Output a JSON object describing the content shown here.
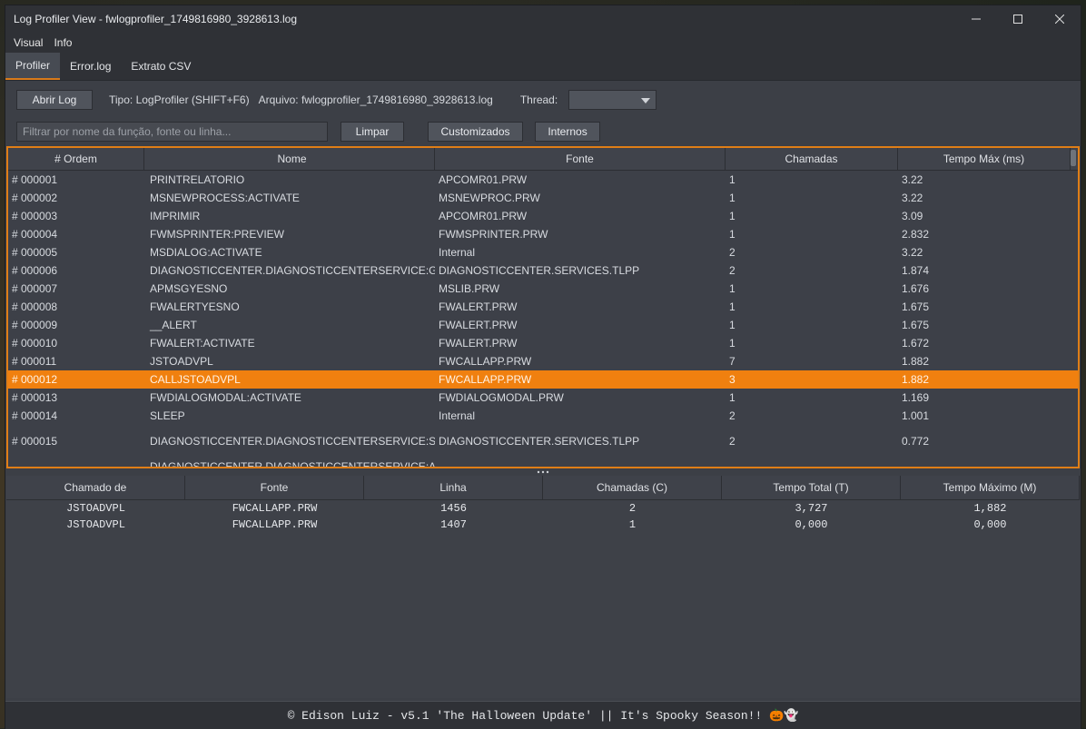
{
  "window": {
    "title": "Log Profiler View - fwlogprofiler_1749816980_3928613.log"
  },
  "menu": [
    "Visual",
    "Info"
  ],
  "tabs": [
    "Profiler",
    "Error.log",
    "Extrato CSV"
  ],
  "toolbar": {
    "open_log": "Abrir Log",
    "type_label": "Tipo: LogProfiler (SHIFT+F6)",
    "file_label": "Arquivo: fwlogprofiler_1749816980_3928613.log",
    "thread_label": "Thread:",
    "thread_value": ""
  },
  "filterbar": {
    "placeholder": "Filtrar por nome da função, fonte ou linha...",
    "clear": "Limpar",
    "custom": "Customizados",
    "internal": "Internos"
  },
  "main_table": {
    "headers": [
      "# Ordem",
      "Nome",
      "Fonte",
      "Chamadas",
      "Tempo Máx (ms)"
    ],
    "selected_index": 11,
    "rows": [
      [
        "# 000001",
        "PRINTRELATORIO",
        "APCOMR01.PRW",
        "1",
        "3.22"
      ],
      [
        "# 000002",
        "MSNEWPROCESS:ACTIVATE",
        "MSNEWPROC.PRW",
        "1",
        "3.22"
      ],
      [
        "# 000003",
        "IMPRIMIR",
        "APCOMR01.PRW",
        "1",
        "3.09"
      ],
      [
        "# 000004",
        "FWMSPRINTER:PREVIEW",
        "FWMSPRINTER.PRW",
        "1",
        "2.832"
      ],
      [
        "# 000005",
        "MSDIALOG:ACTIVATE",
        "Internal",
        "2",
        "3.22"
      ],
      [
        "# 000006",
        "DIAGNOSTICCENTER.DIAGNOSTICCENTERSERVICE:GET",
        "DIAGNOSTICCENTER.SERVICES.TLPP",
        "2",
        "1.874"
      ],
      [
        "# 000007",
        "APMSGYESNO",
        "MSLIB.PRW",
        "1",
        "1.676"
      ],
      [
        "# 000008",
        "FWALERTYESNO",
        "FWALERT.PRW",
        "1",
        "1.675"
      ],
      [
        "# 000009",
        "__ALERT",
        "FWALERT.PRW",
        "1",
        "1.675"
      ],
      [
        "# 000010",
        "FWALERT:ACTIVATE",
        "FWALERT.PRW",
        "1",
        "1.672"
      ],
      [
        "# 000011",
        "JSTOADVPL",
        "FWCALLAPP.PRW",
        "7",
        "1.882"
      ],
      [
        "# 000012",
        "CALLJSTOADVPL",
        "FWCALLAPP.PRW",
        "3",
        "1.882"
      ],
      [
        "# 000013",
        "FWDIALOGMODAL:ACTIVATE",
        "FWDIALOGMODAL.PRW",
        "1",
        "1.169"
      ],
      [
        "# 000014",
        "SLEEP",
        "Internal",
        "2",
        "1.001"
      ],
      [
        "# 000015",
        "DIAGNOSTICCENTER.DIAGNOSTICCENTERSERVICE:SMARTCLIENTRELEASE",
        "DIAGNOSTICCENTER.SERVICES.TLPP",
        "2",
        "0.772"
      ],
      [
        "",
        "DIAGNOSTICCENTER.DIAGNOSTICCENTERSERVICE:APPSE",
        "",
        "",
        ""
      ]
    ]
  },
  "detail_table": {
    "headers": [
      "Chamado de",
      "Fonte",
      "Linha",
      "Chamadas (C)",
      "Tempo Total (T)",
      "Tempo Máximo (M)"
    ],
    "rows": [
      [
        "JSTOADVPL",
        "FWCALLAPP.PRW",
        "1456",
        "2",
        "3,727",
        "1,882"
      ],
      [
        "JSTOADVPL",
        "FWCALLAPP.PRW",
        "1407",
        "1",
        "0,000",
        "0,000"
      ]
    ]
  },
  "footer": {
    "text": "© Edison Luiz - v5.1 'The Halloween Update' || It's Spooky Season!! 🎃👻"
  },
  "colors": {
    "accent": "#e07e16",
    "selected_row": "#f0800f",
    "background": "#3c3f46"
  }
}
